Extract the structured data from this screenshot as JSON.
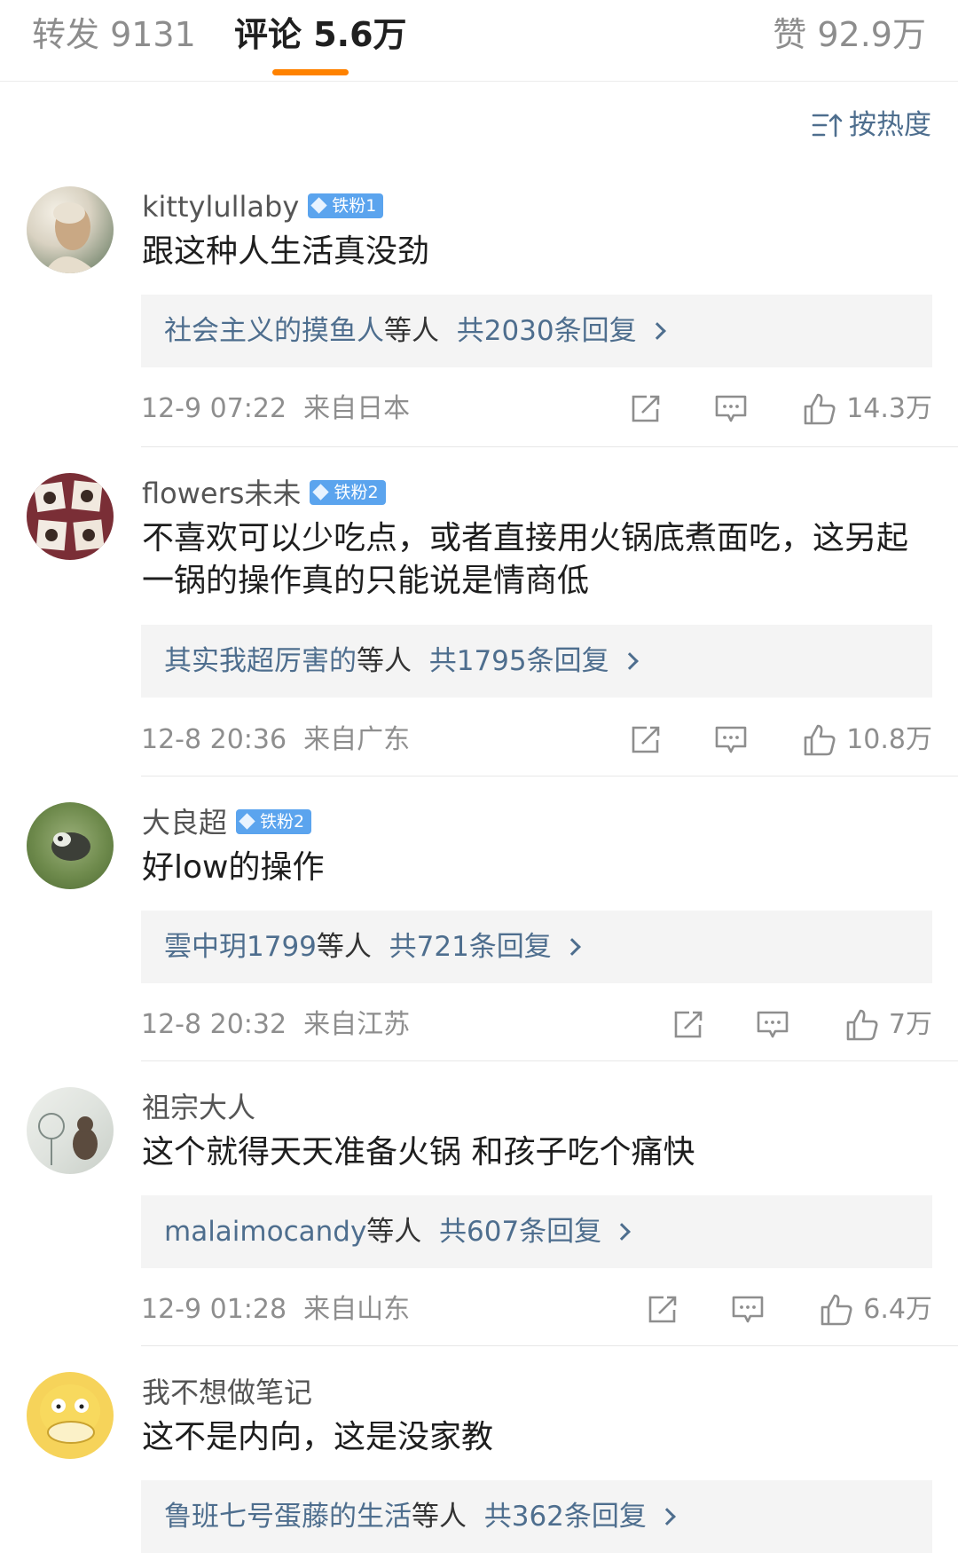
{
  "tabs": {
    "repost": "转发 9131",
    "comments": "评论 5.6万",
    "likes": "赞 92.9万",
    "accent_color": "#ff8200"
  },
  "sort": {
    "label": "按热度",
    "icon": "sort-icon"
  },
  "comments": [
    {
      "username": "kittylullaby",
      "badge": "铁粉1",
      "text": "跟这种人生活真没劲",
      "reply_user": "社会主义的摸鱼人",
      "reply_suffix": "等人",
      "reply_total": "共2030条回复",
      "time": "12-9 07:22",
      "location": "来自日本",
      "likes": "14.3万"
    },
    {
      "username": "flowers未未",
      "badge": "铁粉2",
      "text": "不喜欢可以少吃点，或者直接用火锅底煮面吃，这另起一锅的操作真的只能说是情商低",
      "reply_user": "其实我超厉害的",
      "reply_suffix": "等人",
      "reply_total": "共1795条回复",
      "time": "12-8 20:36",
      "location": "来自广东",
      "likes": "10.8万"
    },
    {
      "username": "大良超",
      "badge": "铁粉2",
      "text": "好low的操作",
      "reply_user": "雲中玥1799",
      "reply_suffix": "等人",
      "reply_total": "共721条回复",
      "time": "12-8 20:32",
      "location": "来自江苏",
      "likes": "7万"
    },
    {
      "username": "祖宗大人",
      "badge": "",
      "text": "这个就得天天准备火锅 和孩子吃个痛快",
      "reply_user": "malaimocandy",
      "reply_suffix": "等人",
      "reply_total": "共607条回复",
      "time": "12-9 01:28",
      "location": "来自山东",
      "likes": "6.4万"
    },
    {
      "username": "我不想做笔记",
      "badge": "",
      "text": "这不是内向，这是没家教",
      "reply_user": "鲁班七号蛋藤的生活",
      "reply_suffix": "等人",
      "reply_total": "共362条回复",
      "time": "",
      "location": "",
      "likes": ""
    }
  ]
}
